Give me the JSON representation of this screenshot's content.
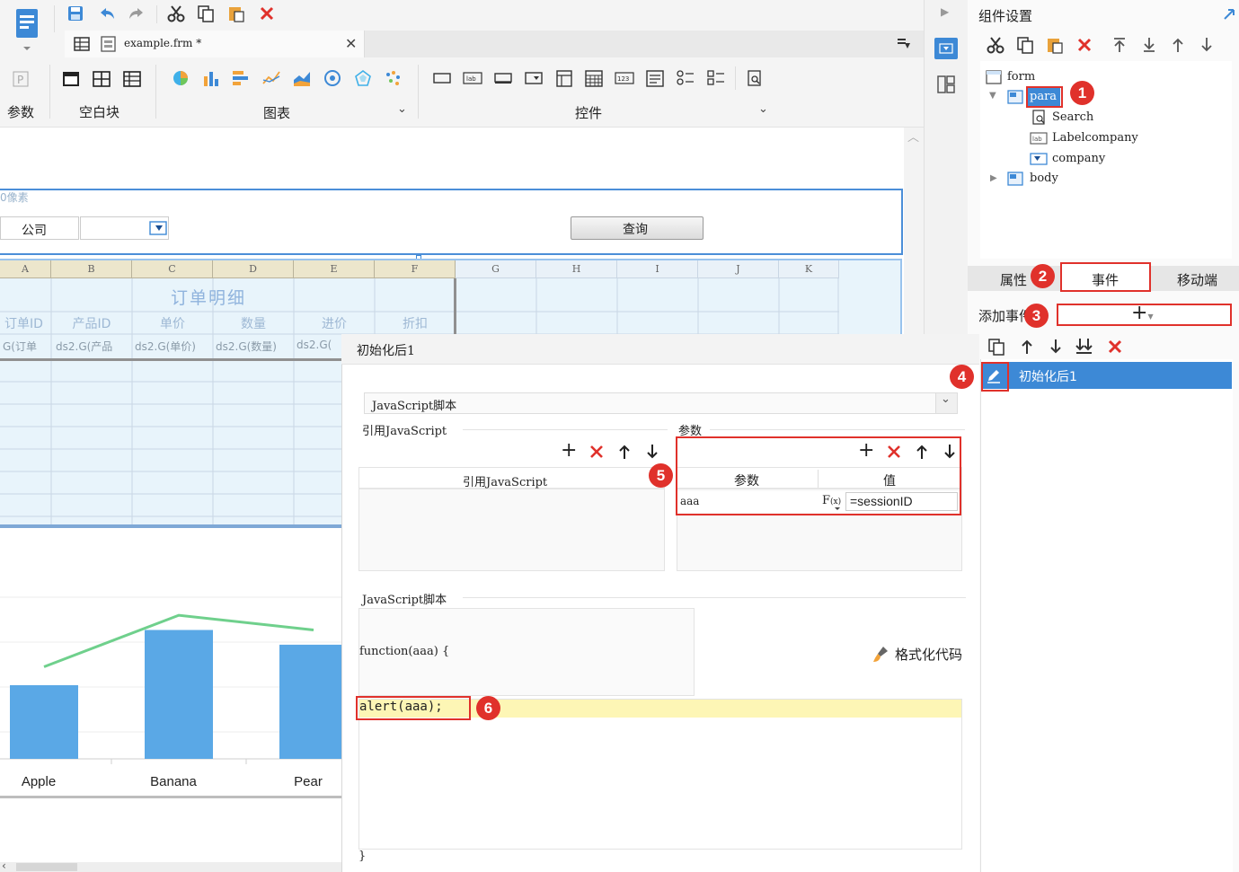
{
  "toolbar": {
    "file_tab": "example.frm *",
    "groups": {
      "param": "参数",
      "blank": "空白块",
      "chart": "图表",
      "widget": "控件"
    }
  },
  "para_panel": {
    "pixel_label": "0像素",
    "company_label": "公司",
    "query_button": "查询"
  },
  "sheet": {
    "col_letters": [
      "A",
      "B",
      "C",
      "D",
      "E",
      "F",
      "G",
      "H",
      "I",
      "J",
      "K"
    ],
    "title": "订单明细",
    "headers": [
      "订单ID",
      "产品ID",
      "单价",
      "数量",
      "进价",
      "折扣"
    ],
    "formulas": [
      "G(订单",
      "ds2.G(产品",
      "ds2.G(单价)",
      "ds2.G(数量)",
      "ds2.G("
    ]
  },
  "chart_data": {
    "type": "bar",
    "categories": [
      "Apple",
      "Banana",
      "Pear"
    ],
    "series": [
      {
        "values": [
          40,
          70,
          62
        ]
      },
      {
        "values": [
          50,
          78,
          70
        ]
      }
    ]
  },
  "dialog": {
    "title": "初始化后1",
    "script_type": "JavaScript脚本",
    "ref_js_label": "引用JavaScript",
    "ref_js_col": "引用JavaScript",
    "params_label": "参数",
    "params_headers": {
      "name": "参数",
      "value": "值"
    },
    "params_rows": [
      {
        "name": "aaa",
        "value": "=sessionID"
      }
    ],
    "js_script_label": "JavaScript脚本",
    "function_sig": "function(aaa) {",
    "format_code": "格式化代码",
    "code_line": "alert(aaa);",
    "closing_brace": "}"
  },
  "right_panel": {
    "title": "组件设置",
    "tree": [
      {
        "label": "form"
      },
      {
        "label": "para"
      },
      {
        "label": "Search"
      },
      {
        "label": "Labelcompany"
      },
      {
        "label": "company"
      },
      {
        "label": "body"
      }
    ],
    "tabs": [
      "属性",
      "事件",
      "移动端"
    ],
    "add_event_label": "添加事件",
    "event_item": "初始化后1"
  },
  "badges": [
    "1",
    "2",
    "3",
    "4",
    "5",
    "6"
  ],
  "colors": {
    "accent": "#3a8ee6",
    "red": "#e0312b",
    "bar": "#5aa8e6",
    "line": "#6fd08c"
  }
}
